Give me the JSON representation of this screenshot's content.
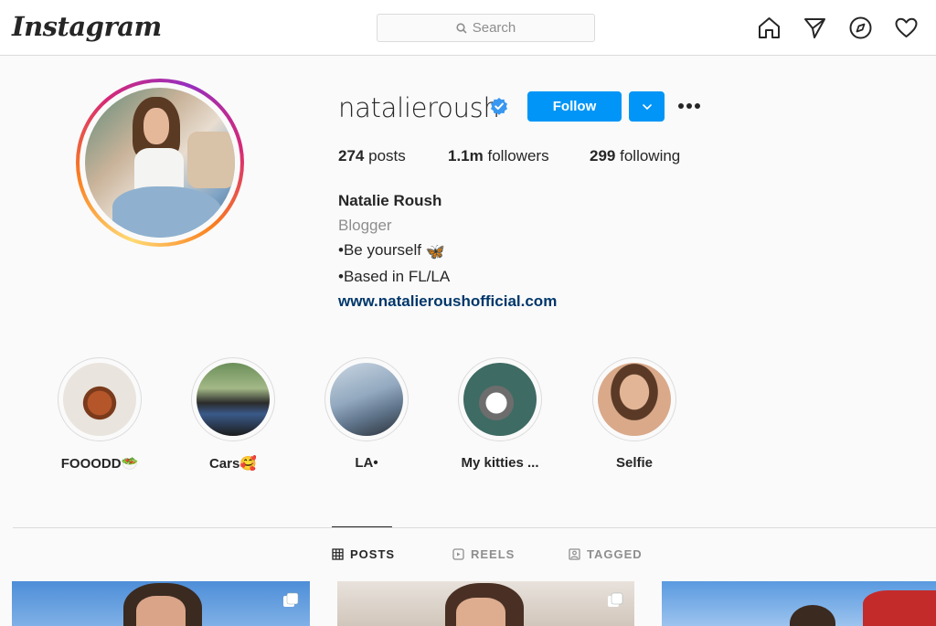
{
  "header": {
    "logo": "Instagram",
    "search_placeholder": "Search",
    "nav_icons": [
      "home-icon",
      "direct-icon",
      "explore-icon",
      "activity-icon"
    ]
  },
  "profile": {
    "username": "natalieroush",
    "verified": true,
    "follow_label": "Follow",
    "stats": {
      "posts_count": "274",
      "posts_label": "posts",
      "followers_count": "1.1m",
      "followers_label": "followers",
      "following_count": "299",
      "following_label": "following"
    },
    "bio": {
      "name": "Natalie Roush",
      "category": "Blogger",
      "line1": "•Be yourself",
      "line1_emoji": "🦋",
      "line2": "•Based in FL/LA",
      "link": "www.natalieroushofficial.com"
    }
  },
  "highlights": [
    {
      "label": "FOOODD",
      "emoji": "🥗"
    },
    {
      "label": "Cars",
      "emoji": "🥰"
    },
    {
      "label": "LA•",
      "emoji": ""
    },
    {
      "label": "My kitties ...",
      "emoji": ""
    },
    {
      "label": "Selfie",
      "emoji": ""
    }
  ],
  "tabs": [
    {
      "label": "POSTS",
      "active": true
    },
    {
      "label": "REELS",
      "active": false
    },
    {
      "label": "TAGGED",
      "active": false
    }
  ],
  "colors": {
    "accent": "#0095f6",
    "link": "#00376b",
    "text": "#262626",
    "muted": "#8e8e8e",
    "border": "#dbdbdb"
  }
}
